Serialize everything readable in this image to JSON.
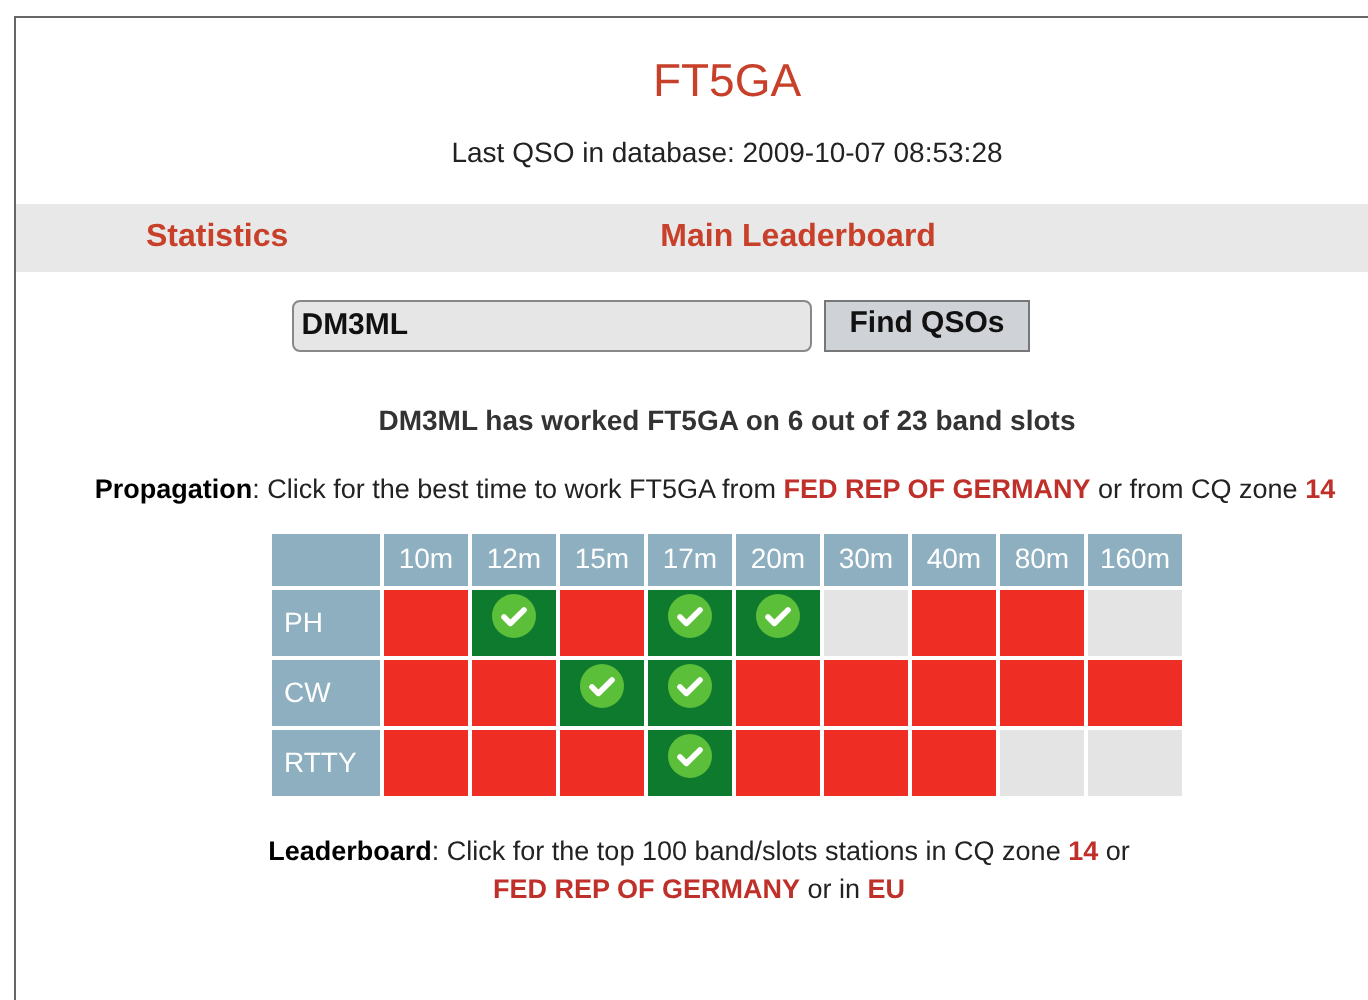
{
  "title": "FT5GA",
  "last_qso": "Last QSO in database: 2009-10-07 08:53:28",
  "nav": [
    {
      "label": "Statistics"
    },
    {
      "label": "Main Leaderboard"
    }
  ],
  "search": {
    "value": "DM3ML",
    "button": "Find QSOs"
  },
  "summary": "DM3ML has worked FT5GA on 6 out of 23 band slots",
  "propagation": [
    {
      "kind": "bold",
      "text": "Propagation"
    },
    {
      "kind": "plain",
      "text": ": Click for the best time to work FT5GA from "
    },
    {
      "kind": "link",
      "text": "FED REP OF GERMANY"
    },
    {
      "kind": "plain",
      "text": " or from CQ zone "
    },
    {
      "kind": "link",
      "text": "14"
    }
  ],
  "table": {
    "bands": [
      "10m",
      "12m",
      "15m",
      "17m",
      "20m",
      "30m",
      "40m",
      "80m",
      "160m"
    ],
    "rows": [
      {
        "mode": "PH",
        "cells": [
          {
            "kind": "needed"
          },
          {
            "kind": "worked"
          },
          {
            "kind": "needed"
          },
          {
            "kind": "worked"
          },
          {
            "kind": "worked"
          },
          {
            "kind": "none"
          },
          {
            "kind": "needed"
          },
          {
            "kind": "needed"
          },
          {
            "kind": "none"
          }
        ]
      },
      {
        "mode": "CW",
        "cells": [
          {
            "kind": "needed"
          },
          {
            "kind": "needed"
          },
          {
            "kind": "worked"
          },
          {
            "kind": "worked"
          },
          {
            "kind": "needed"
          },
          {
            "kind": "needed"
          },
          {
            "kind": "needed"
          },
          {
            "kind": "needed"
          },
          {
            "kind": "needed"
          }
        ]
      },
      {
        "mode": "RTTY",
        "cells": [
          {
            "kind": "needed"
          },
          {
            "kind": "needed"
          },
          {
            "kind": "needed"
          },
          {
            "kind": "worked"
          },
          {
            "kind": "needed"
          },
          {
            "kind": "needed"
          },
          {
            "kind": "needed"
          },
          {
            "kind": "none"
          },
          {
            "kind": "none"
          }
        ]
      }
    ]
  },
  "leaderboard": [
    {
      "kind": "bold",
      "text": "Leaderboard"
    },
    {
      "kind": "plain",
      "text": ": Click for the top 100 band/slots stations in CQ zone "
    },
    {
      "kind": "link",
      "text": "14"
    },
    {
      "kind": "plain",
      "text": " or "
    },
    {
      "kind": "link",
      "text": "FED REP OF GERMANY"
    },
    {
      "kind": "plain",
      "text": " or in "
    },
    {
      "kind": "link",
      "text": "EU"
    }
  ]
}
